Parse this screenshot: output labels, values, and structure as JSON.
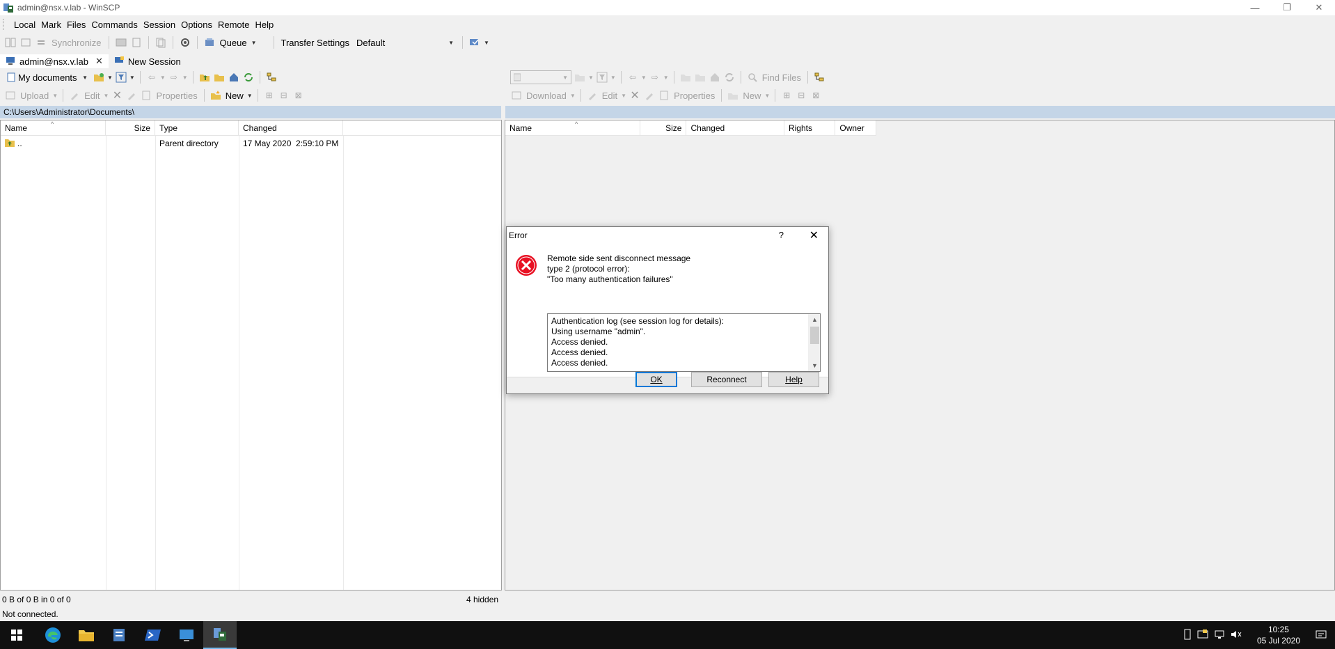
{
  "window": {
    "title": "admin@nsx.v.lab - WinSCP",
    "min_glyph": "—",
    "restore_glyph": "❐",
    "close_glyph": "✕"
  },
  "menu": [
    "Local",
    "Mark",
    "Files",
    "Commands",
    "Session",
    "Options",
    "Remote",
    "Help"
  ],
  "toolbar": {
    "synchronize": "Synchronize",
    "queue": "Queue",
    "transfer_settings": "Transfer Settings",
    "transfer_value": "Default"
  },
  "tabs": [
    {
      "label": "admin@nsx.v.lab"
    },
    {
      "label": "New Session"
    }
  ],
  "local": {
    "location": "My documents",
    "upload": "Upload",
    "edit": "Edit",
    "properties": "Properties",
    "new": "New",
    "path": "C:\\Users\\Administrator\\Documents\\",
    "columns": [
      "Name",
      "Size",
      "Type",
      "Changed"
    ],
    "rows": [
      {
        "name": "..",
        "size": "",
        "type": "Parent directory",
        "changed": "17 May 2020  2:59:10 PM"
      }
    ],
    "status_left": "0 B of 0 B in 0 of 0",
    "status_right": "4 hidden"
  },
  "remote": {
    "find_files": "Find Files",
    "download": "Download",
    "edit": "Edit",
    "properties": "Properties",
    "new": "New",
    "columns": [
      "Name",
      "Size",
      "Changed",
      "Rights",
      "Owner"
    ]
  },
  "status": "Not connected.",
  "dialog": {
    "title": "Error",
    "help_glyph": "?",
    "close_glyph": "✕",
    "message": "Remote side sent disconnect message\ntype 2 (protocol error):\n\"Too many authentication failures\"",
    "log_lines": [
      "Authentication log (see session log for details):",
      "Using username \"admin\".",
      "Access denied.",
      "Access denied.",
      "Access denied."
    ],
    "ok": "OK",
    "reconnect": "Reconnect",
    "help": "Help"
  },
  "taskbar": {
    "time": "10:25",
    "date": "05 Jul 2020"
  },
  "colors": {
    "path_bar": "#c4d5e7",
    "error_red": "#e81123",
    "taskbar": "#101010",
    "accent": "#0078d7"
  }
}
